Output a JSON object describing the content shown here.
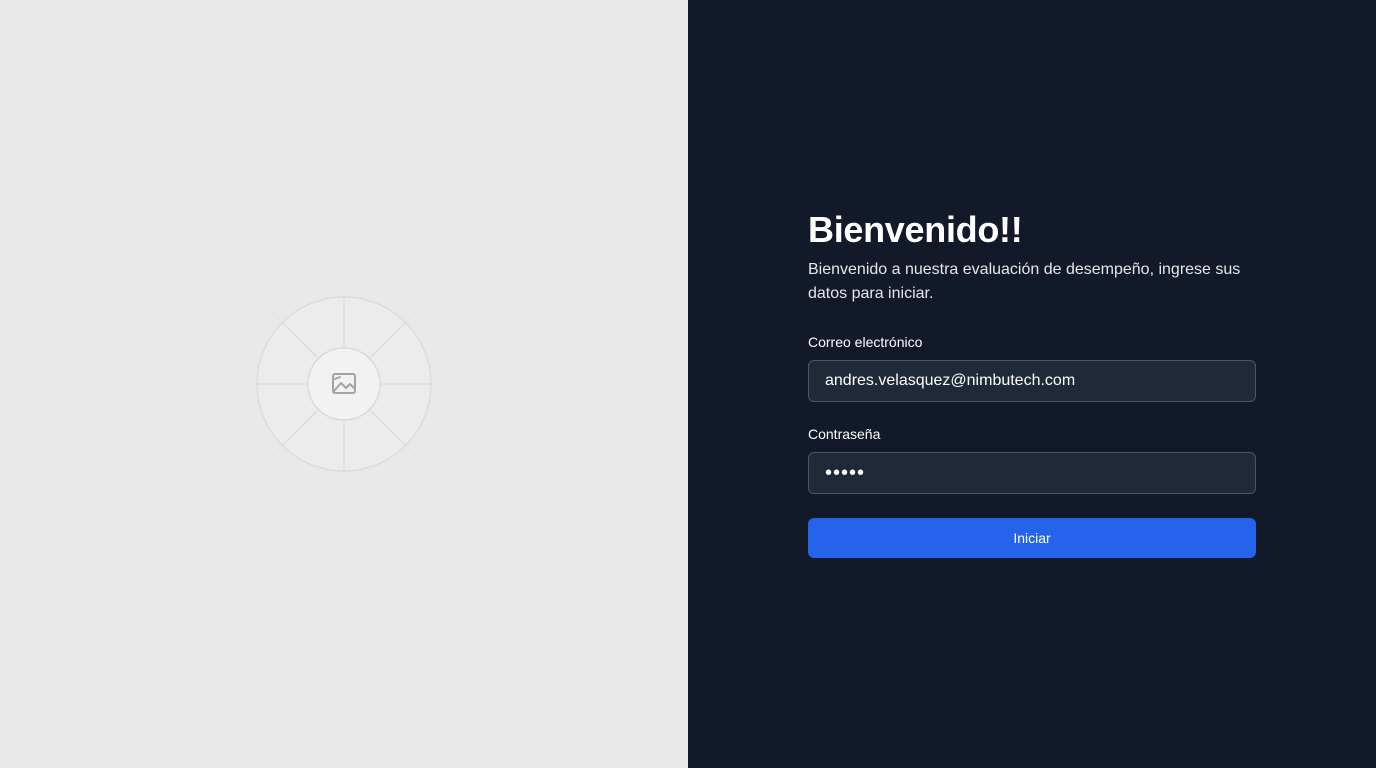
{
  "colors": {
    "left_background": "#e9e9e9",
    "right_background": "#121929",
    "input_background": "#1f2937",
    "input_border": "#4b5563",
    "button": "#2563eb"
  },
  "illustration": {
    "icon": "image-icon"
  },
  "login": {
    "title": "Bienvenido!!",
    "subtitle": "Bienvenido a nuestra evaluación de desempeño, ingrese sus datos para iniciar.",
    "email_label": "Correo electrónico",
    "email_value": "andres.velasquez@nimbutech.com",
    "password_label": "Contraseña",
    "password_value": "•••••",
    "submit_label": "Iniciar"
  }
}
